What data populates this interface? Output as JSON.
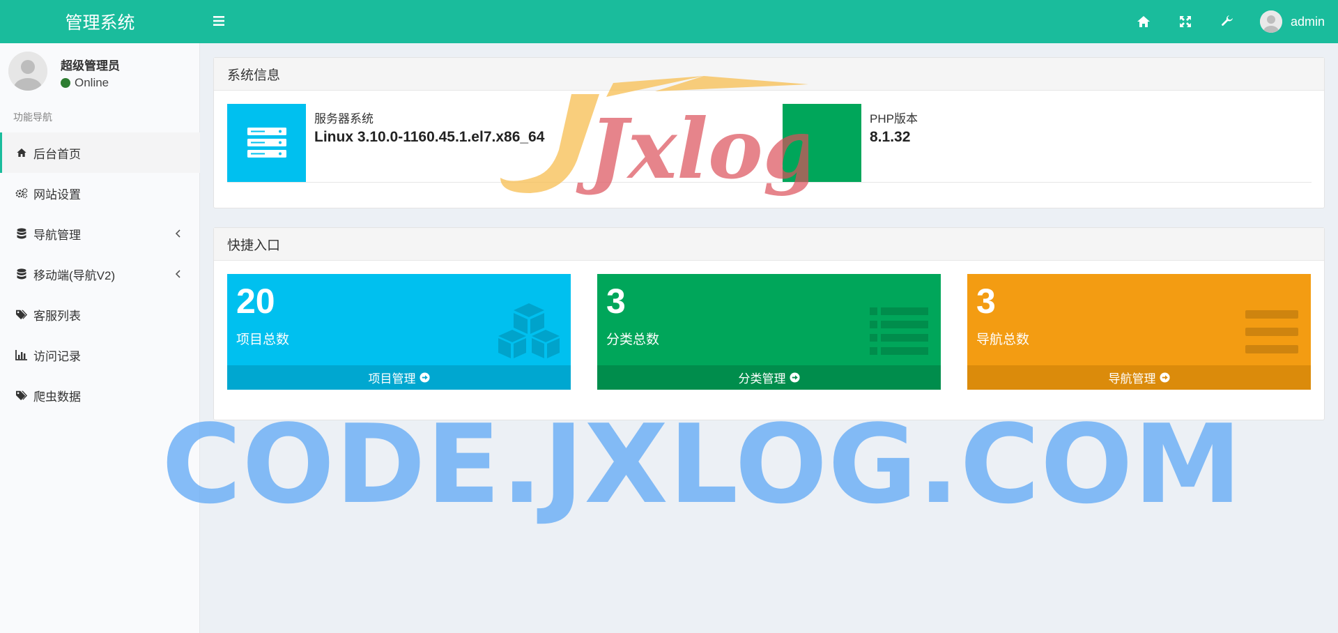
{
  "header": {
    "logo_text": "管理系统",
    "username": "admin",
    "icons": [
      "menu-toggle-icon",
      "home-icon",
      "fullscreen-icon",
      "wrench-icon"
    ],
    "bg_color": "#1abc9c"
  },
  "sidebar": {
    "user_name": "超级管理员",
    "status": "Online",
    "nav_header": "功能导航",
    "items": [
      {
        "label": "后台首页",
        "icon": "home-icon",
        "active": true
      },
      {
        "label": "网站设置",
        "icon": "gears-icon"
      },
      {
        "label": "导航管理",
        "icon": "database-icon",
        "has_submenu": true
      },
      {
        "label": "移动端(导航V2)",
        "icon": "database-icon",
        "has_submenu": true
      },
      {
        "label": "客服列表",
        "icon": "tags-icon"
      },
      {
        "label": "访问记录",
        "icon": "bar-chart-icon"
      },
      {
        "label": "爬虫数据",
        "icon": "tags-icon"
      }
    ]
  },
  "sysinfo": {
    "title": "系统信息",
    "server_label": "服务器系统",
    "server_value": "Linux 3.10.0-1160.45.1.el7.x86_64",
    "php_label": "PHP版本",
    "php_value": "8.1.32"
  },
  "quick": {
    "title": "快捷入口",
    "cards": [
      {
        "number": "20",
        "label": "项目总数",
        "link": "项目管理",
        "color": "#00c0ef",
        "footer_color": "#00a7d0",
        "icon": "cubes-icon"
      },
      {
        "number": "3",
        "label": "分类总数",
        "link": "分类管理",
        "color": "#00a65a",
        "footer_color": "#008d4c",
        "icon": "list-icon"
      },
      {
        "number": "3",
        "label": "导航总数",
        "link": "导航管理",
        "color": "#f39c12",
        "footer_color": "#db8b0b",
        "icon": "bars-icon"
      }
    ]
  },
  "watermarks": {
    "logo_text": "Jxlog",
    "site_text": "CODE.JXLOG.COM"
  }
}
